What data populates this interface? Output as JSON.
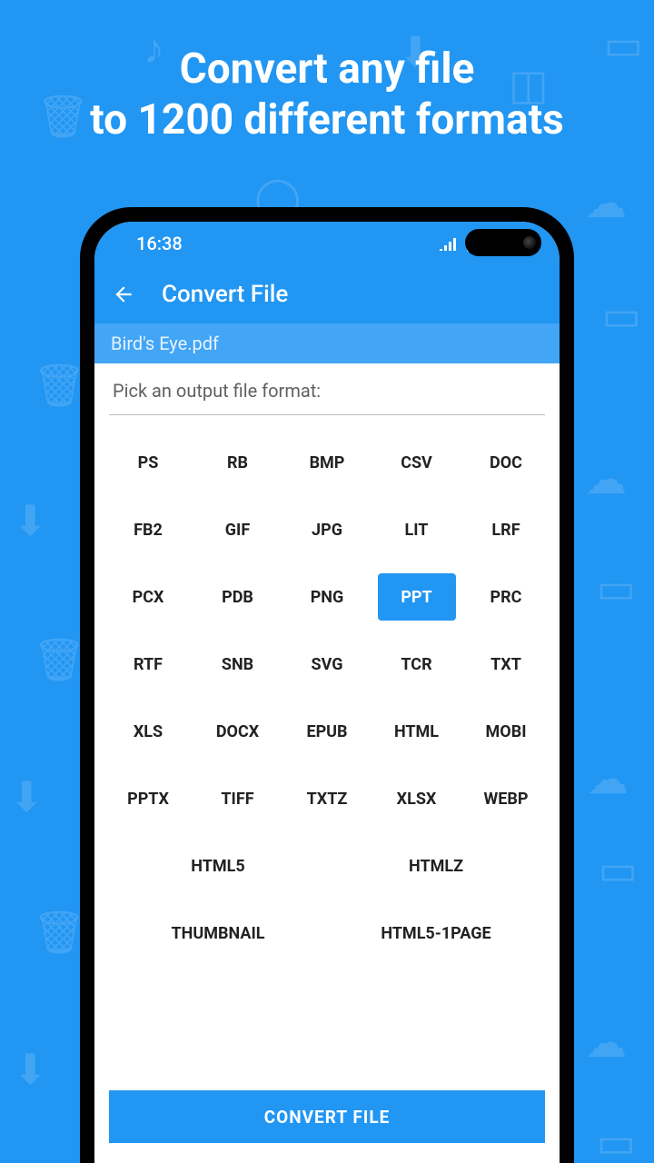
{
  "promo": {
    "line1": "Convert any file",
    "line2": "to 1200 different formats"
  },
  "statusbar": {
    "time": "16:38"
  },
  "appbar": {
    "title": "Convert File"
  },
  "file": {
    "name": "Bird's Eye.pdf"
  },
  "picker": {
    "label": "Pick an output file format:"
  },
  "formats": {
    "r0": [
      "PS",
      "RB",
      "BMP",
      "CSV",
      "DOC"
    ],
    "r1": [
      "FB2",
      "GIF",
      "JPG",
      "LIT",
      "LRF"
    ],
    "r2": [
      "PCX",
      "PDB",
      "PNG",
      "PPT",
      "PRC"
    ],
    "r3": [
      "RTF",
      "SNB",
      "SVG",
      "TCR",
      "TXT"
    ],
    "r4": [
      "XLS",
      "DOCX",
      "EPUB",
      "HTML",
      "MOBI"
    ],
    "r5": [
      "PPTX",
      "TIFF",
      "TXTZ",
      "XLSX",
      "WEBP"
    ],
    "r6": [
      "HTML5",
      "HTMLZ"
    ],
    "r7": [
      "THUMBNAIL",
      "HTML5-1PAGE"
    ],
    "selected": "PPT"
  },
  "actions": {
    "convert": "CONVERT FILE"
  }
}
